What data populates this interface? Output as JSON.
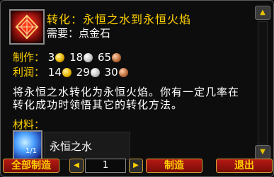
{
  "recipe": {
    "title": "转化：永恒之水到永恒火焰",
    "requires": "需要：点金石"
  },
  "cost": {
    "label": "制作：",
    "gold": "3",
    "silver": "18",
    "copper": "65"
  },
  "profit": {
    "label": "利润：",
    "gold": "14",
    "silver": "29",
    "copper": "30"
  },
  "description": "将永恒之水转化为永恒火焰。你有一定几率在转化成功时领悟其它的转化方法。",
  "materials": {
    "label": "材料：",
    "items": [
      {
        "name": "永恒之水",
        "count": "1/1"
      }
    ]
  },
  "buttons": {
    "create_all": "全部制造",
    "create": "制造",
    "exit": "退出",
    "decrement": "◀",
    "increment": "▶"
  },
  "quantity": {
    "value": "1"
  },
  "scroll": {
    "up": "▲",
    "down": "▼"
  }
}
